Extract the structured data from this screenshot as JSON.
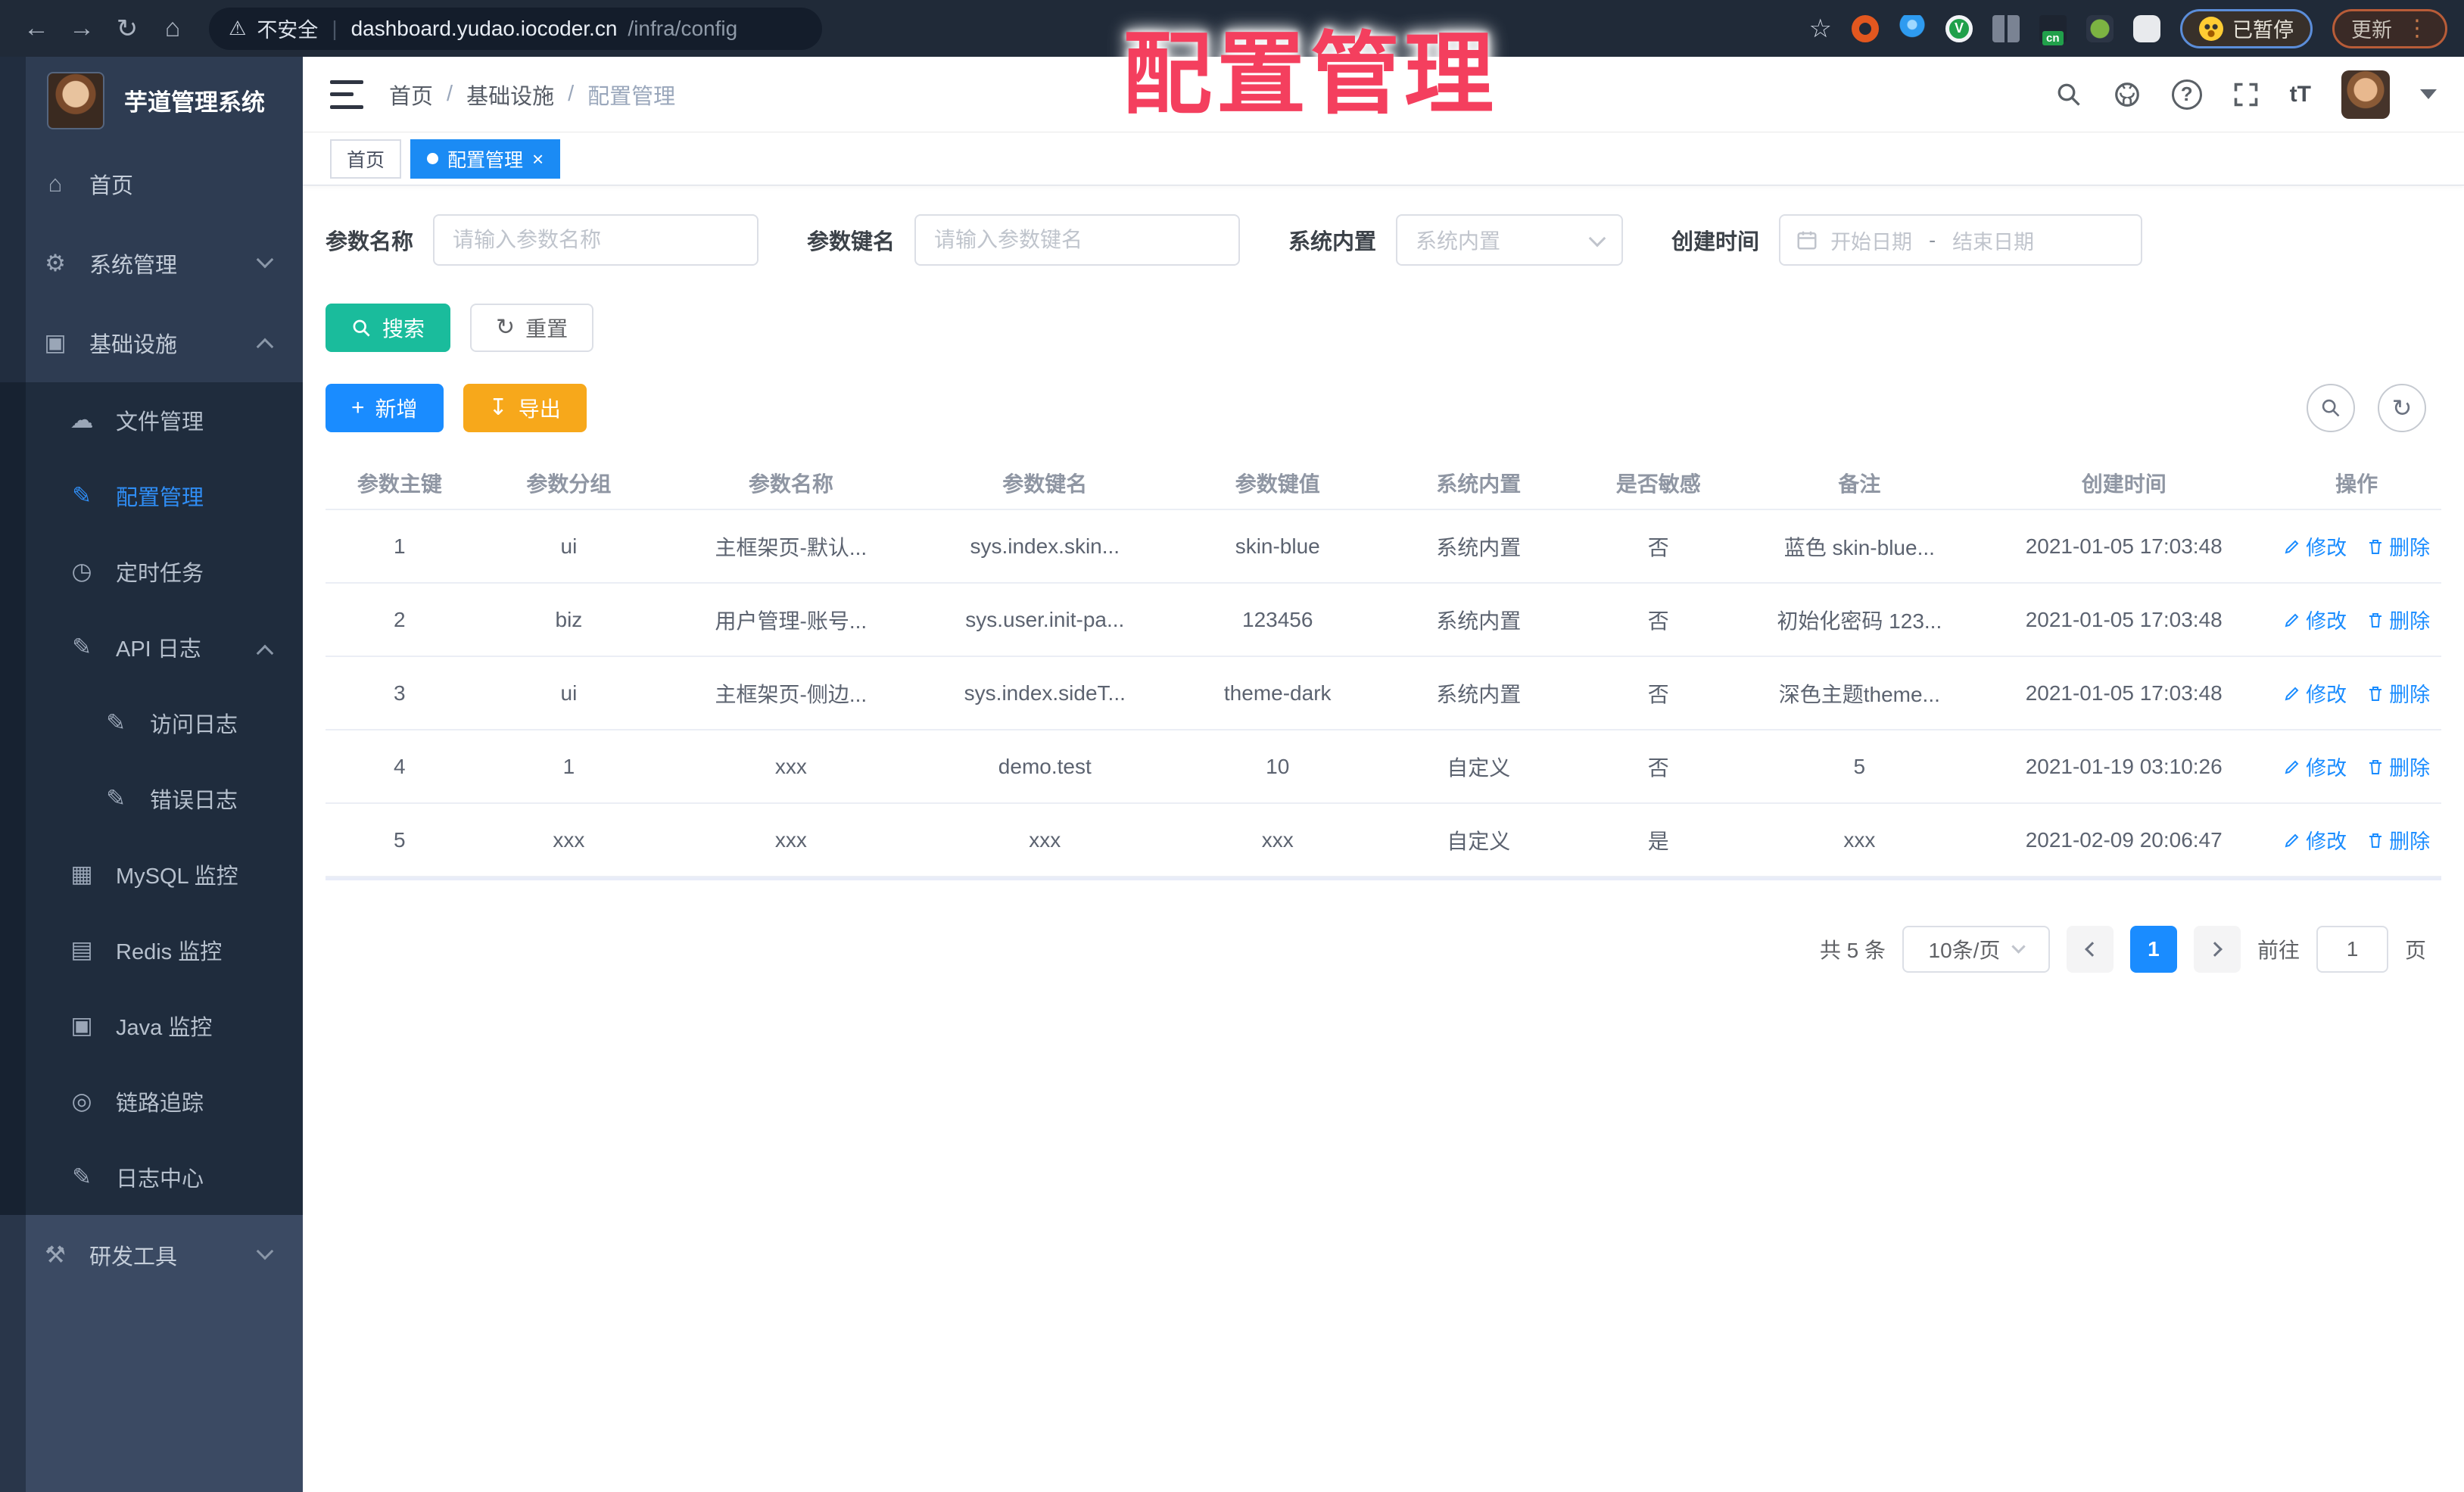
{
  "theme": {
    "accent_blue": "#1a8cff",
    "teal": "#1abc9c",
    "orange": "#f7a81b",
    "overlay_red": "#f43f5e",
    "sidebar_bg": "#2e3c52",
    "submenu_bg": "#1f2c3d",
    "sidebar_bottom_bg": "#3b4a63",
    "browser_bg": "#202a38"
  },
  "overlay_title": "配置管理",
  "browser": {
    "insecure_label": "不安全",
    "url_host": "dashboard.yudao.iocoder.cn",
    "url_path": "/infra/config",
    "paused_label": "已暂停",
    "update_label": "更新",
    "kebab": "⋮",
    "nav": {
      "back": "←",
      "forward": "→",
      "reload": "↻",
      "home": "⌂",
      "star": "☆",
      "warning": "⚠"
    },
    "extensions": [
      {
        "name": "extension-orange-ring-icon",
        "shape": "ring",
        "text": ""
      },
      {
        "name": "extension-blue-pin-icon",
        "shape": "pin",
        "text": ""
      },
      {
        "name": "extension-green-v-icon",
        "shape": "greenv",
        "text": "V"
      },
      {
        "name": "extension-grid-icon",
        "shape": "grid",
        "text": ""
      },
      {
        "name": "extension-cn-badge-icon",
        "shape": "badge",
        "text": "cn"
      },
      {
        "name": "extension-leaf-icon",
        "shape": "leaf",
        "text": ""
      },
      {
        "name": "extension-puzzle-icon",
        "shape": "puzzle",
        "text": ""
      }
    ]
  },
  "sidebar": {
    "app_title": "芋道管理系统",
    "top_items": [
      {
        "label": "首页",
        "icon": "home-icon",
        "level": 0
      },
      {
        "label": "系统管理",
        "icon": "gear-icon",
        "level": 0,
        "chevron": "down"
      },
      {
        "label": "基础设施",
        "icon": "infra-icon",
        "level": 0,
        "chevron": "up"
      }
    ],
    "sub_items": [
      {
        "label": "文件管理",
        "icon": "cloud-icon",
        "level": 1
      },
      {
        "label": "配置管理",
        "icon": "edit-icon",
        "level": 1,
        "active": true
      },
      {
        "label": "定时任务",
        "icon": "timer-icon",
        "level": 1
      },
      {
        "label": "API 日志",
        "icon": "api-log-icon",
        "level": 1,
        "chevron": "up"
      },
      {
        "label": "访问日志",
        "icon": "access-log-icon",
        "level": 2
      },
      {
        "label": "错误日志",
        "icon": "error-log-icon",
        "level": 2
      },
      {
        "label": "MySQL 监控",
        "icon": "mysql-icon",
        "level": 1
      },
      {
        "label": "Redis 监控",
        "icon": "redis-icon",
        "level": 1
      },
      {
        "label": "Java 监控",
        "icon": "java-icon",
        "level": 1
      },
      {
        "label": "链路追踪",
        "icon": "trace-icon",
        "level": 1
      },
      {
        "label": "日志中心",
        "icon": "log-center-icon",
        "level": 1
      }
    ],
    "bottom_items": [
      {
        "label": "研发工具",
        "icon": "tools-icon",
        "level": 0,
        "chevron": "down"
      }
    ]
  },
  "icon_glyphs": {
    "home-icon": "⌂",
    "gear-icon": "⚙",
    "infra-icon": "▣",
    "cloud-icon": "☁",
    "edit-icon": "✎",
    "timer-icon": "◷",
    "api-log-icon": "✎",
    "access-log-icon": "✎",
    "error-log-icon": "✎",
    "mysql-icon": "▦",
    "redis-icon": "▤",
    "java-icon": "▣",
    "trace-icon": "◎",
    "log-center-icon": "✎",
    "tools-icon": "⚒"
  },
  "topbar": {
    "breadcrumb": [
      "首页",
      "基础设施",
      "配置管理"
    ],
    "separator": "/",
    "font_icon_label": "tT",
    "help_label": "?"
  },
  "tags": [
    {
      "label": "首页",
      "active": false,
      "closable": false
    },
    {
      "label": "配置管理",
      "active": true,
      "closable": true
    }
  ],
  "filters": {
    "name_label": "参数名称",
    "name_placeholder": "请输入参数名称",
    "key_label": "参数键名",
    "key_placeholder": "请输入参数键名",
    "type_label": "系统内置",
    "type_placeholder": "系统内置",
    "date_label": "创建时间",
    "date_start_placeholder": "开始日期",
    "date_separator": "-",
    "date_end_placeholder": "结束日期"
  },
  "buttons": {
    "search": "搜索",
    "reset": "重置",
    "add": "新增",
    "export": "导出",
    "reset_icon": "↻",
    "add_icon": "+",
    "export_icon": "↧"
  },
  "table": {
    "headers": [
      "参数主键",
      "参数分组",
      "参数名称",
      "参数键名",
      "参数键值",
      "系统内置",
      "是否敏感",
      "备注",
      "创建时间",
      "操作"
    ],
    "actions": {
      "edit": "修改",
      "delete": "删除"
    },
    "rows": [
      {
        "cells": [
          "1",
          "ui",
          "主框架页-默认...",
          "sys.index.skin...",
          "skin-blue",
          "系统内置",
          "否",
          "蓝色 skin-blue...",
          "2021-01-05 17:03:48"
        ]
      },
      {
        "cells": [
          "2",
          "biz",
          "用户管理-账号...",
          "sys.user.init-pa...",
          "123456",
          "系统内置",
          "否",
          "初始化密码 123...",
          "2021-01-05 17:03:48"
        ]
      },
      {
        "cells": [
          "3",
          "ui",
          "主框架页-侧边...",
          "sys.index.sideT...",
          "theme-dark",
          "系统内置",
          "否",
          "深色主题theme...",
          "2021-01-05 17:03:48"
        ]
      },
      {
        "cells": [
          "4",
          "1",
          "xxx",
          "demo.test",
          "10",
          "自定义",
          "否",
          "5",
          "2021-01-19 03:10:26"
        ]
      },
      {
        "cells": [
          "5",
          "xxx",
          "xxx",
          "xxx",
          "xxx",
          "自定义",
          "是",
          "xxx",
          "2021-02-09 20:06:47"
        ]
      }
    ]
  },
  "pagination": {
    "total": "共 5 条",
    "page_size": "10条/页",
    "current_page": "1",
    "goto_label": "前往",
    "goto_value": "1",
    "page_unit": "页"
  }
}
